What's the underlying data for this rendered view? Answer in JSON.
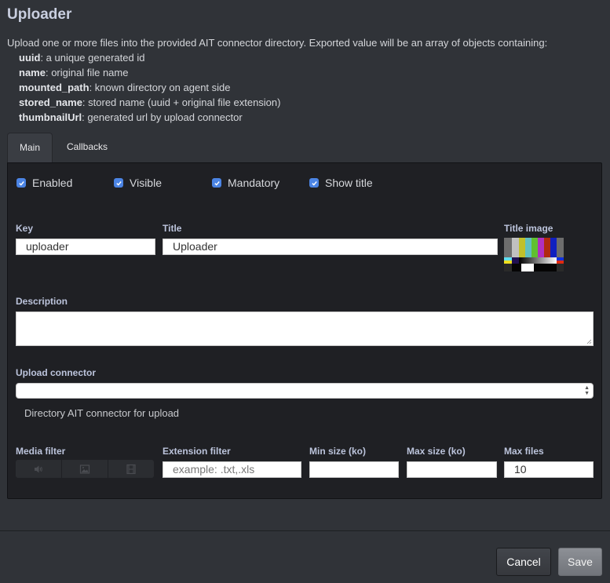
{
  "header": {
    "title": "Uploader",
    "description": "Upload one or more files into the provided AIT connector directory. Exported value will be an array of objects containing:",
    "fields": [
      {
        "key": "uuid",
        "text": ": a unique generated id"
      },
      {
        "key": "name",
        "text": ": original file name"
      },
      {
        "key": "mounted_path",
        "text": ": known directory on agent side"
      },
      {
        "key": "stored_name",
        "text": ": stored name (uuid + original file extension)"
      },
      {
        "key": "thumbnailUrl",
        "text": ": generated url by upload connector"
      }
    ]
  },
  "tabs": [
    {
      "label": "Main",
      "active": true
    },
    {
      "label": "Callbacks",
      "active": false
    }
  ],
  "checkboxes": [
    {
      "label": "Enabled",
      "checked": true
    },
    {
      "label": "Visible",
      "checked": true
    },
    {
      "label": "Mandatory",
      "checked": true
    },
    {
      "label": "Show title",
      "checked": true
    }
  ],
  "form": {
    "key_label": "Key",
    "key_value": "uploader",
    "title_label": "Title",
    "title_value": "Uploader",
    "title_image_label": "Title image",
    "description_label": "Description",
    "description_value": "",
    "connector_label": "Upload connector",
    "connector_value": "",
    "connector_help": "Directory AIT connector for upload",
    "media_filter_label": "Media filter",
    "media_filter_options": [
      "audio-icon",
      "image-icon",
      "video-icon"
    ],
    "extension_filter_label": "Extension filter",
    "extension_filter_placeholder": "example: .txt,.xls",
    "min_size_label": "Min size (ko)",
    "min_size_value": "",
    "max_size_label": "Max size (ko)",
    "max_size_value": "",
    "max_files_label": "Max files",
    "max_files_value": "10"
  },
  "footer": {
    "cancel_label": "Cancel",
    "save_label": "Save"
  },
  "colors": {
    "accent_checkbox": "#4b84e4",
    "background": "#303338",
    "panel": "#1f2024"
  }
}
